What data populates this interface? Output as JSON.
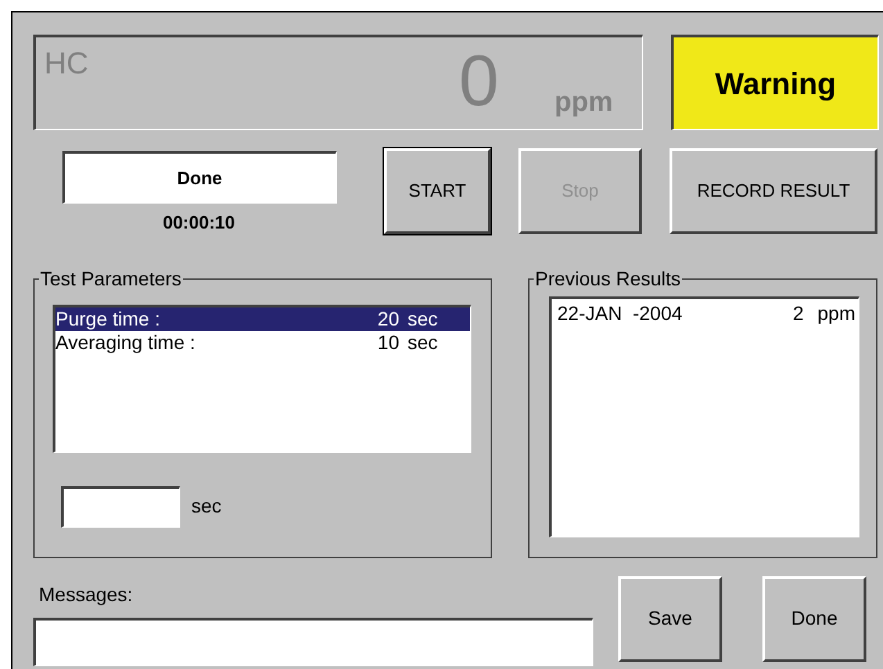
{
  "readout": {
    "label": "HC",
    "value": "0",
    "unit": "ppm"
  },
  "warning": "Warning",
  "status": {
    "text": "Done",
    "timer": "00:00:10"
  },
  "buttons": [
    {
      "label": "START",
      "default": true,
      "disabled": false
    },
    {
      "label": "Stop",
      "default": false,
      "disabled": true
    },
    {
      "label": "RECORD RESULT",
      "default": false,
      "disabled": false
    }
  ],
  "test_parameters": {
    "title": "Test Parameters",
    "rows": [
      {
        "name": "Purge time :",
        "value": "20",
        "unit": "sec",
        "selected": true
      },
      {
        "name": "Averaging time :",
        "value": "10",
        "unit": "sec",
        "selected": false
      }
    ],
    "input_unit": "sec"
  },
  "previous_results": {
    "title": "Previous Results",
    "rows": [
      {
        "date": "22-JAN  -2004",
        "value": "2",
        "unit": "ppm"
      }
    ]
  },
  "messages": {
    "label": "Messages:"
  },
  "bottom_buttons": [
    {
      "label": "Save"
    },
    {
      "label": "Done"
    }
  ]
}
